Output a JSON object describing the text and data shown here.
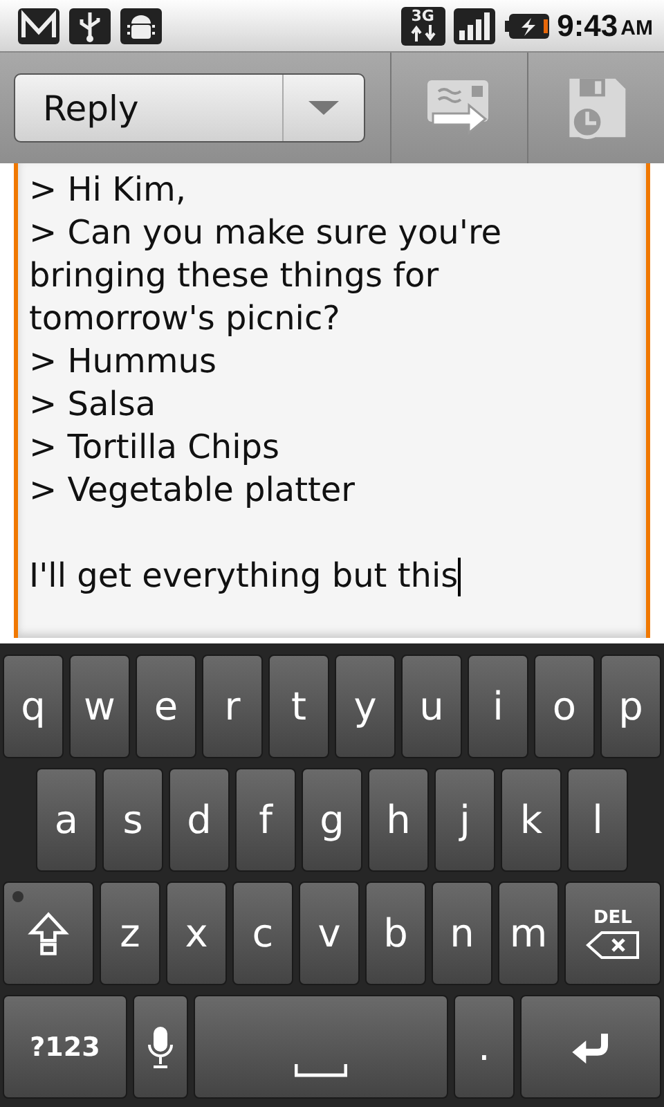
{
  "status_bar": {
    "time": "9:43",
    "ampm": "AM",
    "network": "3G"
  },
  "action_bar": {
    "mode_dropdown": {
      "value": "Reply"
    }
  },
  "message": {
    "quoted_lines": [
      "> Hi Kim,",
      "> Can you make sure you're bringing these things for tomorrow's picnic?",
      "> Hummus",
      "> Salsa",
      "> Tortilla Chips",
      "> Vegetable platter"
    ],
    "reply": "I'll get everything but this"
  },
  "keyboard": {
    "rows": [
      [
        {
          "kind": "letter",
          "label": "q"
        },
        {
          "kind": "letter",
          "label": "w"
        },
        {
          "kind": "letter",
          "label": "e"
        },
        {
          "kind": "letter",
          "label": "r"
        },
        {
          "kind": "letter",
          "label": "t"
        },
        {
          "kind": "letter",
          "label": "y"
        },
        {
          "kind": "letter",
          "label": "u"
        },
        {
          "kind": "letter",
          "label": "i"
        },
        {
          "kind": "letter",
          "label": "o"
        },
        {
          "kind": "letter",
          "label": "p"
        }
      ],
      [
        {
          "kind": "letter",
          "label": "a"
        },
        {
          "kind": "letter",
          "label": "s"
        },
        {
          "kind": "letter",
          "label": "d"
        },
        {
          "kind": "letter",
          "label": "f"
        },
        {
          "kind": "letter",
          "label": "g"
        },
        {
          "kind": "letter",
          "label": "h"
        },
        {
          "kind": "letter",
          "label": "j"
        },
        {
          "kind": "letter",
          "label": "k"
        },
        {
          "kind": "letter",
          "label": "l"
        }
      ],
      [
        {
          "kind": "shift"
        },
        {
          "kind": "letter",
          "label": "z"
        },
        {
          "kind": "letter",
          "label": "x"
        },
        {
          "kind": "letter",
          "label": "c"
        },
        {
          "kind": "letter",
          "label": "v"
        },
        {
          "kind": "letter",
          "label": "b"
        },
        {
          "kind": "letter",
          "label": "n"
        },
        {
          "kind": "letter",
          "label": "m"
        },
        {
          "kind": "delete",
          "label": "DEL"
        }
      ],
      [
        {
          "kind": "symbols",
          "label": "?123"
        },
        {
          "kind": "mic"
        },
        {
          "kind": "space"
        },
        {
          "kind": "letter",
          "label": "."
        },
        {
          "kind": "enter"
        }
      ]
    ]
  }
}
